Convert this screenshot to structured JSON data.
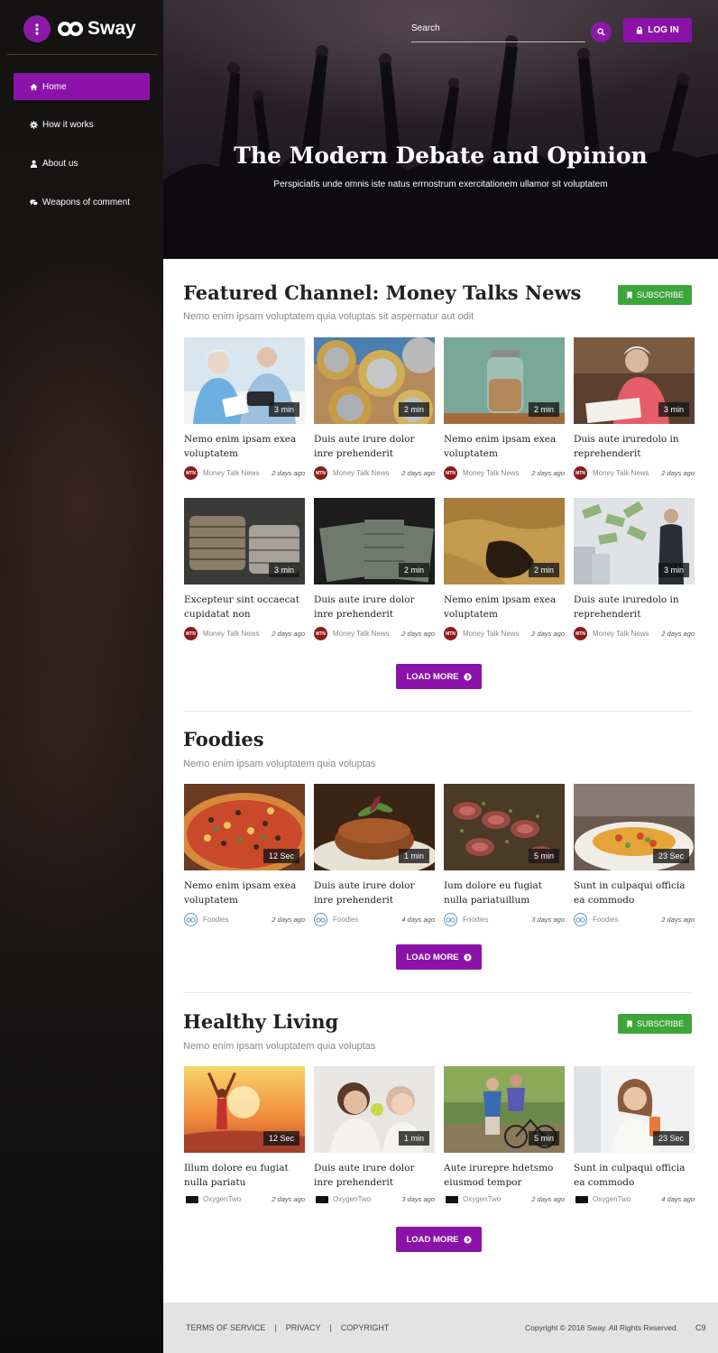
{
  "brand": {
    "name": "Sway",
    "accent": "#8b12a9",
    "subscribe_color": "#3ea53a"
  },
  "sidebar": {
    "items": [
      {
        "label": "Home",
        "icon": "home-icon",
        "active": true
      },
      {
        "label": "How it works",
        "icon": "gear-icon"
      },
      {
        "label": "About us",
        "icon": "user-icon"
      },
      {
        "label": "Weapons of comment",
        "icon": "comments-icon"
      }
    ]
  },
  "header": {
    "search_placeholder": "Search",
    "login_label": "LOG IN"
  },
  "hero": {
    "title": "The Modern Debate and Opinion",
    "subtitle": "Perspiciatis unde omnis iste natus errnostrum exercitationem ullamor sit voluptatem"
  },
  "sections": [
    {
      "title": "Featured Channel: Money Talks News",
      "subtitle": "Nemo enim ipsam voluptatem quia voluptas sit aspernatur aut odit",
      "subscribe_label": "SUBSCRIBE",
      "load_more_label": "LOAD MORE",
      "cards": [
        {
          "title": "Nemo enim ipsam exea voluptatem",
          "duration": "3 min",
          "channel": "Money Talk News",
          "ago": "2 days ago",
          "avatar_text": "MTN",
          "image": "elderly-couple-paperwork"
        },
        {
          "title": "Duis aute irure dolor inre prehenderit",
          "duration": "2 min",
          "channel": "Money Talk News",
          "ago": "2 days ago",
          "avatar_text": "MTN",
          "image": "coins"
        },
        {
          "title": "Nemo enim ipsam exea voluptatem",
          "duration": "2 min",
          "channel": "Money Talk News",
          "ago": "2 days ago",
          "avatar_text": "MTN",
          "image": "coin-jar"
        },
        {
          "title": "Duis aute iruredolo in reprehenderit",
          "duration": "3 min",
          "channel": "Money Talk News",
          "ago": "2 days ago",
          "avatar_text": "MTN",
          "image": "woman-writing"
        },
        {
          "title": "Excepteur sint occaecat cupidatat non",
          "duration": "3 min",
          "channel": "Money Talk News",
          "ago": "2 days ago",
          "avatar_text": "MTN",
          "image": "coin-stacks"
        },
        {
          "title": "Duis aute irure dolor inre prehenderit",
          "duration": "2 min",
          "channel": "Money Talk News",
          "ago": "2 days ago",
          "avatar_text": "MTN",
          "image": "cash-bundles"
        },
        {
          "title": "Nemo enim ipsam exea voluptatem",
          "duration": "2 min",
          "channel": "Money Talk News",
          "ago": "2 days ago",
          "avatar_text": "MTN",
          "image": "empty-pocket"
        },
        {
          "title": "Duis aute iruredolo in reprehenderit",
          "duration": "3 min",
          "channel": "Money Talk News",
          "ago": "2 days ago",
          "avatar_text": "MTN",
          "image": "businessman-money"
        }
      ]
    },
    {
      "title": "Foodies",
      "subtitle": "Nemo enim ipsam voluptatem quia voluptas",
      "load_more_label": "LOAD MORE",
      "cards": [
        {
          "title": "Nemo enim ipsam exea voluptatem",
          "duration": "12 Sec",
          "channel": "Foodies",
          "ago": "2 days ago",
          "image": "pizza"
        },
        {
          "title": "Duis aute irure dolor inre prehenderit",
          "duration": "1 min",
          "channel": "Foodies",
          "ago": "4 days ago",
          "image": "burger-patty"
        },
        {
          "title": "Ium dolore eu fugiat nulla pariatuillum",
          "duration": "5 min",
          "channel": "Foodies",
          "ago": "3 days ago",
          "image": "steak-slices"
        },
        {
          "title": "Sunt in culpaqui officia ea commodo",
          "duration": "23 Sec",
          "channel": "Foodies",
          "ago": "2 days ago",
          "image": "dinner-plate"
        }
      ]
    },
    {
      "title": "Healthy Living",
      "subtitle": "Nemo enim ipsam voluptatem quia voluptas",
      "subscribe_label": "SUBSCRIBE",
      "load_more_label": "LOAD MORE",
      "cards": [
        {
          "title": "Illum dolore eu fugiat nulla pariatu",
          "duration": "12 Sec",
          "channel": "OxygenTwo",
          "ago": "2 days ago",
          "image": "sunset-woman"
        },
        {
          "title": "Duis aute irure dolor inre prehenderit",
          "duration": "1 min",
          "channel": "OxygenTwo",
          "ago": "3 days ago",
          "image": "mother-daughter-apple"
        },
        {
          "title": "Aute irurepre hdetsmo eiusmod tempor",
          "duration": "5 min",
          "channel": "OxygenTwo",
          "ago": "2 days ago",
          "image": "couple-bike"
        },
        {
          "title": "Sunt in culpaqui officia ea commodo",
          "duration": "23 Sec",
          "channel": "OxygenTwo",
          "ago": "4 days ago",
          "image": "woman-juice"
        }
      ]
    }
  ],
  "footer": {
    "links": [
      "TERMS OF SERVICE",
      "PRIVACY",
      "COPYRIGHT"
    ],
    "copyright": "Copyright © 2018 Sway. All Rights Reserved.",
    "extra": "C9"
  }
}
